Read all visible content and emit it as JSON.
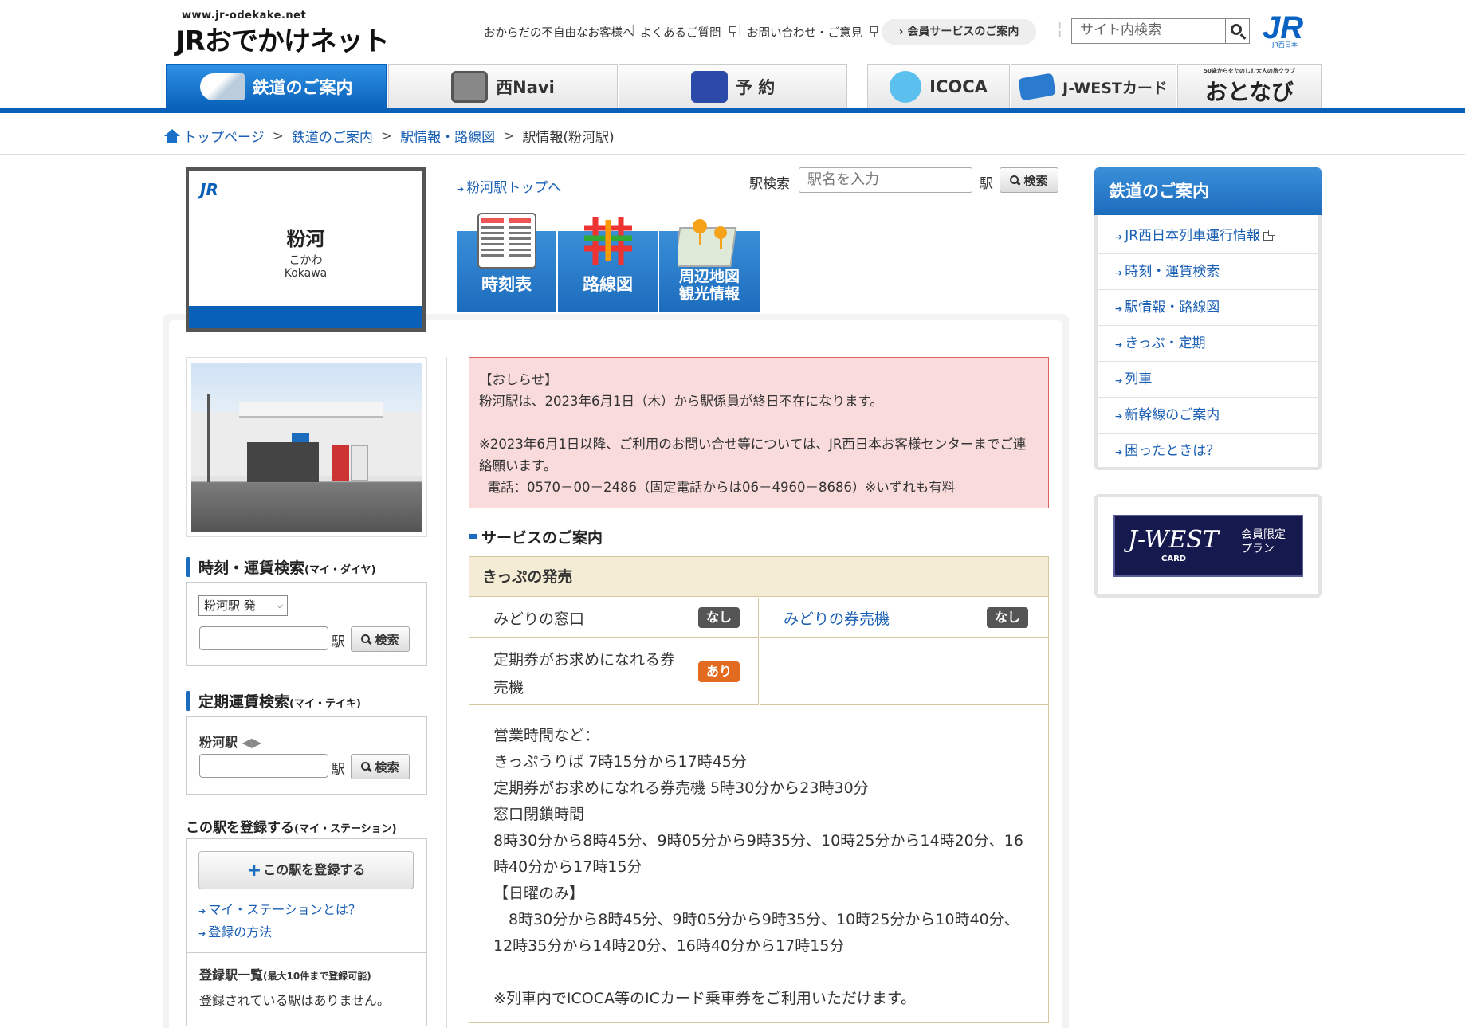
{
  "header": {
    "logo_url": "www.jr-odekake.net",
    "logo_text": "JRおでかけネット",
    "util_links": [
      "おからだの不自由なお客様へ",
      "よくあるご質問",
      "お問い合わせ・ご意見"
    ],
    "member_button": "会員サービスのご案内",
    "site_search_placeholder": "サイト内検索",
    "jr_logo_caption": "JR西日本"
  },
  "nav": {
    "tabs": [
      "鉄道のご案内",
      "西Navi",
      "予 約",
      "ICOCA",
      "J-WESTカード",
      "おとなび"
    ],
    "otonabi_caption": "50歳からをたのしむ大人の旅クラブ"
  },
  "breadcrumb": [
    "トップページ",
    "鉄道のご案内",
    "駅情報・路線図",
    "駅情報(粉河駅)"
  ],
  "station": {
    "badge": "JR",
    "name": "粉河",
    "kana": "こかわ",
    "roman": "Kokawa",
    "top_link": "粉河駅トップへ"
  },
  "station_search": {
    "label": "駅検索",
    "placeholder": "駅名を入力",
    "suffix": "駅",
    "button": "検索"
  },
  "station_tabs": [
    "時刻表",
    "路線図",
    "周辺地図\n観光情報"
  ],
  "left": {
    "fare_search": {
      "title": "時刻・運賃検索",
      "sub": "(マイ・ダイヤ)",
      "from": "粉河駅 発",
      "suffix": "駅",
      "button": "検索"
    },
    "pass_search": {
      "title": "定期運賃検索",
      "sub": "(マイ・テイキ)",
      "from": "粉河駅",
      "suffix": "駅",
      "button": "検索"
    },
    "register": {
      "title": "この駅を登録する",
      "sub": "(マイ・ステーション)",
      "button": "この駅を登録する",
      "links": [
        "マイ・ステーションとは？",
        "登録の方法"
      ],
      "list_title": "登録駅一覧",
      "list_sub": "(最大10件まで登録可能)",
      "list_empty": "登録されている駅はありません。"
    }
  },
  "notice": {
    "title": "【おしらせ】",
    "lines": [
      "粉河駅は、2023年6月1日（木）から駅係員が終日不在になります。",
      "",
      "※2023年6月1日以降、ご利用のお問い合せ等については、JR西日本お客様センターまでご連絡願います。",
      "  電話：0570－00－2486（固定電話からは06－4960－8686）※いずれも有料"
    ]
  },
  "service": {
    "heading": "サービスのご案内",
    "box_title": "きっぷの発売",
    "rows": [
      {
        "label": "みどりの窓口",
        "status": "なし"
      },
      {
        "label": "みどりの券売機",
        "status": "なし"
      },
      {
        "label": "定期券がお求めになれる券売機",
        "status": "あり"
      }
    ],
    "hours": [
      "営業時間など：",
      "きっぷうりば 7時15分から17時45分",
      "定期券がお求めになれる券売機 5時30分から23時30分",
      "窓口閉鎖時間",
      "8時30分から8時45分、9時05分から9時35分、10時25分から14時20分、16時40分から17時15分",
      "【日曜のみ】",
      "　8時30分から8時45分、9時05分から9時35分、10時25分から10時40分、12時35分から14時20分、16時40分から17時15分",
      "",
      "※列車内でICOCA等のICカード乗車券をご利用いただけます。"
    ]
  },
  "right": {
    "menu_title": "鉄道のご案内",
    "menu_items": [
      "JR西日本列車運行情報",
      "時刻・運賃検索",
      "駅情報・路線図",
      "きっぷ・定期",
      "列車",
      "新幹線のご案内",
      "困ったときは？"
    ],
    "jwest": {
      "brand": "J-WEST",
      "brand_sub": "CARD",
      "label": "会員限定\nプラン"
    }
  },
  "colors": {
    "brand_blue": "#0860b8",
    "notice_bg": "#f9dbdc",
    "service_header_bg": "#f4ecd4",
    "badge_none": "#555555",
    "badge_yes": "#e26b1f"
  }
}
